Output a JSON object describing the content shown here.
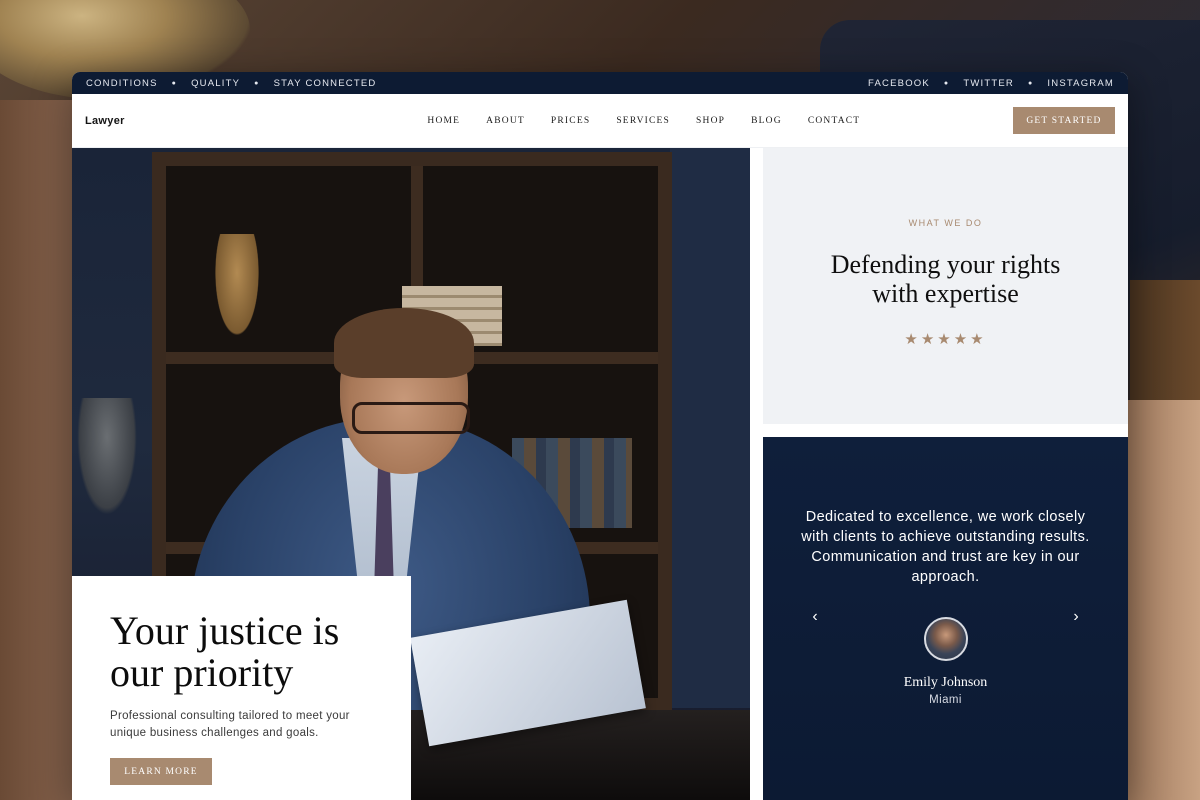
{
  "topbar": {
    "left": [
      "CONDITIONS",
      "QUALITY",
      "STAY CONNECTED"
    ],
    "right": [
      "FACEBOOK",
      "TWITTER",
      "INSTAGRAM"
    ]
  },
  "navbar": {
    "brand": "Lawyer",
    "menu": [
      "HOME",
      "ABOUT",
      "PRICES",
      "SERVICES",
      "SHOP",
      "BLOG",
      "CONTACT"
    ],
    "cta": "GET STARTED"
  },
  "hero": {
    "title": "Your justice is our priority",
    "subtitle": "Professional consulting tailored to meet your unique business challenges and goals.",
    "button": "LEARN MORE"
  },
  "what": {
    "eyebrow": "WHAT WE DO",
    "title_line1": "Defending your rights",
    "title_line2": "with expertise",
    "stars": "★★★★★",
    "rating": 5
  },
  "testimonial": {
    "text": "Dedicated to excellence, we work closely with clients to achieve outstanding results. Communication and trust are key in our approach.",
    "name": "Emily Johnson",
    "city": "Miami",
    "prev_icon": "‹",
    "next_icon": "›"
  },
  "colors": {
    "accent": "#a88a70",
    "navy": "#0f1f3b",
    "light_panel": "#f0f2f5"
  }
}
